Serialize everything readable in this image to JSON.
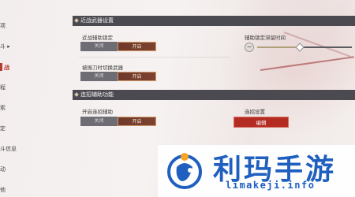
{
  "sidebar": {
    "items": [
      {
        "label": "项"
      },
      {
        "label": "斗 ▸"
      },
      {
        "label": "战",
        "active": true
      },
      {
        "label": "程"
      },
      {
        "label": "索"
      },
      {
        "label": "定"
      },
      {
        "label": "斗信息"
      },
      {
        "label": "动"
      },
      {
        "label": "他"
      }
    ]
  },
  "melee": {
    "title": "近战武器设置",
    "assist_lock": {
      "label": "近战辅助锁定",
      "off": "关闭",
      "on": "开启",
      "value": "开启"
    },
    "switch_weapon": {
      "label": "被振刀时切换武器",
      "off": "关闭",
      "on": "开启",
      "value": "开启"
    },
    "lock_time": {
      "label": "辅助锁定滞留时间",
      "minus": "−",
      "plus": "+",
      "level": 0.45
    }
  },
  "combo": {
    "title": "连招辅助功能",
    "enable": {
      "label": "开启连招辅助",
      "off": "关闭",
      "on": "开启",
      "value": "开启"
    },
    "settings": {
      "label": "连招设置",
      "edit": "编辑"
    }
  },
  "watermark": {
    "title": "利玛手游",
    "url": "limakeji.info"
  },
  "colors": {
    "accent": "#b42b22",
    "section_bg": "#4a4a50",
    "toggle_off": "#6d6d73",
    "watermark": "#1f5fbf"
  }
}
